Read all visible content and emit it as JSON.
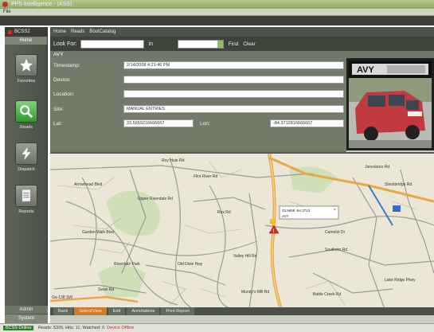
{
  "window": {
    "title": "PPS Intelligence - (ASS)",
    "menu": [
      "File"
    ]
  },
  "sidebar": {
    "brand": "BCSS2",
    "home_tab": "Home",
    "items": [
      {
        "label": "Favorites",
        "icon": "star-icon"
      },
      {
        "label": "Reads",
        "icon": "magnifier-icon"
      },
      {
        "label": "Dispatch",
        "icon": "lightning-icon"
      },
      {
        "label": "Reports",
        "icon": "document-icon"
      }
    ],
    "admin": "Admin",
    "system": "System"
  },
  "toolbar": {
    "tabs": [
      "Home",
      "Reads",
      "BootCatalog"
    ]
  },
  "search": {
    "look_for_label": "Look For:",
    "look_for_value": "",
    "in_label": "in",
    "in_value": "",
    "find": "Find",
    "clear": "Clear"
  },
  "record": {
    "header": "AVY",
    "timestamp_label": "Timestamp:",
    "timestamp_value": "2/14/2008 4:21:46 PM",
    "device_label": "Device:",
    "device_value": "",
    "location_label": "Location:",
    "location_value": "",
    "site_label": "Site:",
    "site_value": "MANUAL ENTRIES",
    "lat_label": "Lat:",
    "lat_value": "33.5659216666667",
    "lon_label": "Lon:",
    "lon_value": "-84.3712816666667"
  },
  "photo": {
    "plate_text": "AVY"
  },
  "map": {
    "callout_line1": "33.5659 -84.3713",
    "callout_line2": "AVY",
    "labels": [
      "Roy Huie Rd",
      "Flint River Rd",
      "Upper Riverdale Rd",
      "Camelot Dr",
      "Southern Rd",
      "Lake Ridge Pkwy",
      "Old Dixie Hwy",
      "Mundy's Mill Rd",
      "Battle Creek Rd",
      "Jonesboro Rd",
      "Stockbridge Rd",
      "Swan Rd",
      "Riverdale Park",
      "Ga-138 SW",
      "Valley Hill Rd",
      "Arrowhead Blvd",
      "Garden Walk Blvd",
      "Rex Rd"
    ]
  },
  "bottom_tabs": [
    "Back",
    "Select/View",
    "Edit",
    "Annotations",
    "Print Report"
  ],
  "status": {
    "online": "BCSS Online",
    "text": "Reads: 5326, Hits: 11, Watched: 0.",
    "offline": "Device Offline"
  },
  "colors": {
    "accent_green": "#2f9a2a",
    "active_tab": "#d07a2a",
    "marker_red": "#d0302a",
    "highway": "#e7a84a"
  }
}
